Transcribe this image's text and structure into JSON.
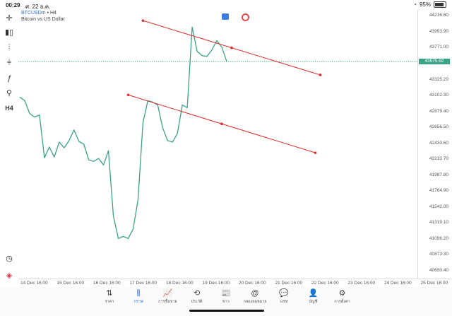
{
  "status": {
    "time": "00:29",
    "date": "ศ. 22 ธ.ค.",
    "battery": "95%"
  },
  "symbol": {
    "name": "BTCUSDm",
    "separator": "•",
    "timeframe": "H4",
    "description": "Bitcoin vs US Dollar"
  },
  "toolbar": {
    "timeframe_label": "H4"
  },
  "chart_data": {
    "type": "line",
    "series_color": "#3aa386",
    "x_labels": [
      "14 Dec 16:00",
      "15 Dec 16:00",
      "16 Dec 16:00",
      "17 Dec 16:00",
      "18 Dec 16:00",
      "19 Dec 16:00",
      "20 Dec 16:00",
      "21 Dec 16:00",
      "22 Dec 16:00",
      "23 Dec 16:00",
      "24 Dec 16:00",
      "25 Dec 16:00"
    ],
    "y_ticks": [
      "44216.80",
      "43993.90",
      "43771.00",
      "43548.10",
      "43325.20",
      "43102.30",
      "42879.40",
      "42656.50",
      "42433.60",
      "42210.70",
      "41987.80",
      "41764.90",
      "41542.00",
      "41319.10",
      "41096.20",
      "40873.30",
      "40650.40"
    ],
    "ylim": [
      40540,
      44300
    ],
    "current_price": "43575.92",
    "values": [
      43080,
      43030,
      42850,
      42800,
      42830,
      42230,
      42380,
      42240,
      42450,
      42370,
      42470,
      42620,
      42460,
      42420,
      42200,
      42180,
      42220,
      42130,
      42330,
      41420,
      41100,
      41130,
      41100,
      41230,
      41640,
      42720,
      43030,
      43010,
      42970,
      42650,
      42470,
      42450,
      42570,
      42970,
      42930,
      44060,
      43720,
      43660,
      43650,
      43740,
      43870,
      43780,
      43580
    ],
    "trendlines": [
      {
        "color": "#dd2b2b",
        "x1": 25,
        "y1": 44150,
        "x2": 61,
        "y2": 43390
      },
      {
        "color": "#dd2b2b",
        "x1": 22,
        "y1": 43110,
        "x2": 60,
        "y2": 42300
      }
    ]
  },
  "nav": [
    {
      "label": "ราคา",
      "icon": "⇅",
      "active": false
    },
    {
      "label": "กราฟ",
      "icon": "⫼",
      "active": true
    },
    {
      "label": "การซื้อขาย",
      "icon": "📈",
      "active": false
    },
    {
      "label": "ประวัติ",
      "icon": "⟲",
      "active": false
    },
    {
      "label": "ข่าว",
      "icon": "📰",
      "active": false
    },
    {
      "label": "กล่องจดหมาย",
      "icon": "@",
      "active": false
    },
    {
      "label": "แชท",
      "icon": "💬",
      "active": false
    },
    {
      "label": "บัญชี",
      "icon": "👤",
      "active": false
    },
    {
      "label": "การตั้งค่า",
      "icon": "⚙",
      "active": false
    }
  ]
}
